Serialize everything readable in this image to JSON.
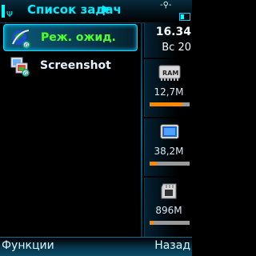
{
  "statusbar": {
    "title": "Список задач",
    "title_arrow": "▶",
    "network_indicator": "-⚲-",
    "signal_icon": "signal-strength-icon",
    "battery_icon": "battery-icon"
  },
  "tasks": [
    {
      "label": "Реж. ожид.",
      "icon": "standby-globe-icon",
      "selected": true
    },
    {
      "label": "Screenshot",
      "icon": "screenshot-app-icon",
      "selected": false
    }
  ],
  "panel": {
    "time": "16.34",
    "date": "Вс 20",
    "resources": [
      {
        "name": "ram",
        "icon": "ram-chip-icon",
        "icon_text": "RAM",
        "value": "12,7M",
        "usage_fraction": 0.82
      },
      {
        "name": "phone-memory",
        "icon": "phone-memory-icon",
        "value": "38,2M",
        "usage_fraction": 0.15
      },
      {
        "name": "memory-card",
        "icon": "memory-card-icon",
        "value": "896M",
        "usage_fraction": 0.08
      }
    ]
  },
  "softkeys": {
    "left": "Функции",
    "right": "Назад"
  },
  "colors": {
    "accent": "#00e5ff",
    "selected_text": "#4eff2e",
    "usage_bar": "#ff8a00",
    "usage_track": "#9a9a9a"
  }
}
